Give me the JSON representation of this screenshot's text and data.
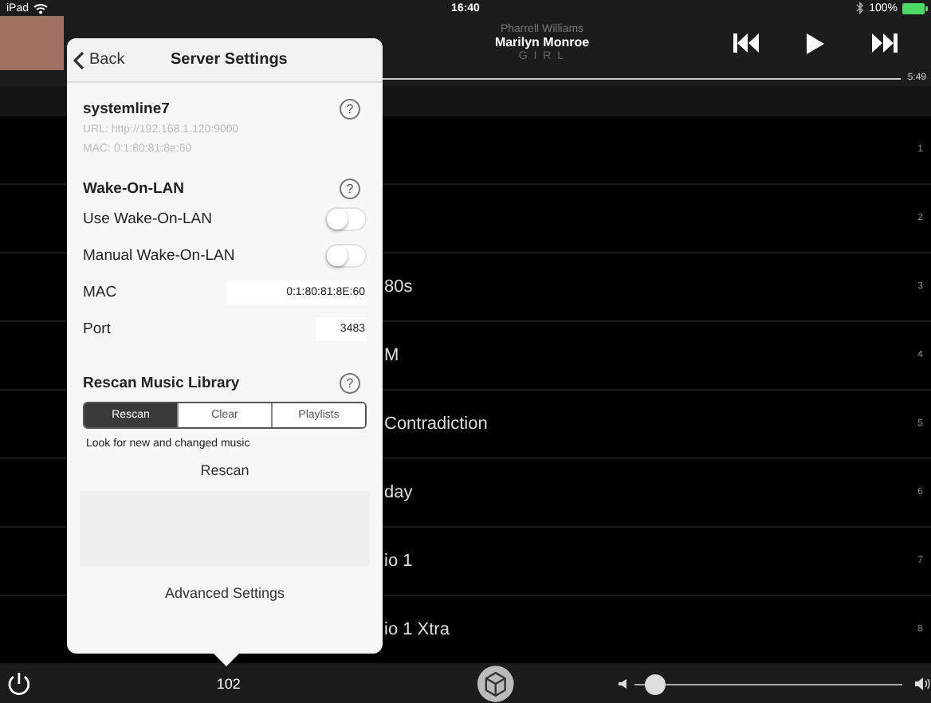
{
  "status_bar": {
    "device": "iPad",
    "time": "16:40",
    "battery": "100%"
  },
  "now_playing": {
    "artist": "Pharrell Williams",
    "title": "Marilyn Monroe",
    "album": "G I R L",
    "duration": "5:49"
  },
  "popover": {
    "back": "Back",
    "title": "Server Settings",
    "server": {
      "name": "systemline7",
      "help": "?",
      "url": "URL: http://192.168.1.120:9000",
      "mac": "MAC: 0:1:80:81:8e:60"
    },
    "wake_on_lan": {
      "heading": "Wake-On-LAN",
      "help": "?",
      "toggles": [
        {
          "label": "Use Wake-On-LAN",
          "on": false
        },
        {
          "label": "Manual Wake-On-LAN",
          "on": false
        }
      ],
      "fields": [
        {
          "label": "MAC",
          "value": "0:1:80:81:8E:60"
        },
        {
          "label": "Port",
          "value": "3483"
        }
      ]
    },
    "rescan": {
      "heading": "Rescan Music Library",
      "help": "?",
      "segments": [
        {
          "label": "Rescan",
          "selected": true
        },
        {
          "label": "Clear",
          "selected": false
        },
        {
          "label": "Playlists",
          "selected": false
        }
      ],
      "description": "Look for new and changed music",
      "button": "Rescan"
    },
    "advanced": "Advanced Settings"
  },
  "rows": [
    {
      "number": "1"
    },
    {
      "number": "2"
    },
    {
      "title": "80s",
      "number": "3"
    },
    {
      "title": "M",
      "number": "4"
    },
    {
      "title": "Contradiction",
      "number": "5"
    },
    {
      "title": "day",
      "number": "6"
    },
    {
      "title": "io 1",
      "number": "7"
    },
    {
      "title": "io 1 Xtra",
      "number": "8"
    }
  ],
  "bottom_bar": {
    "count": "102",
    "volume": {
      "level": 0.08
    }
  }
}
